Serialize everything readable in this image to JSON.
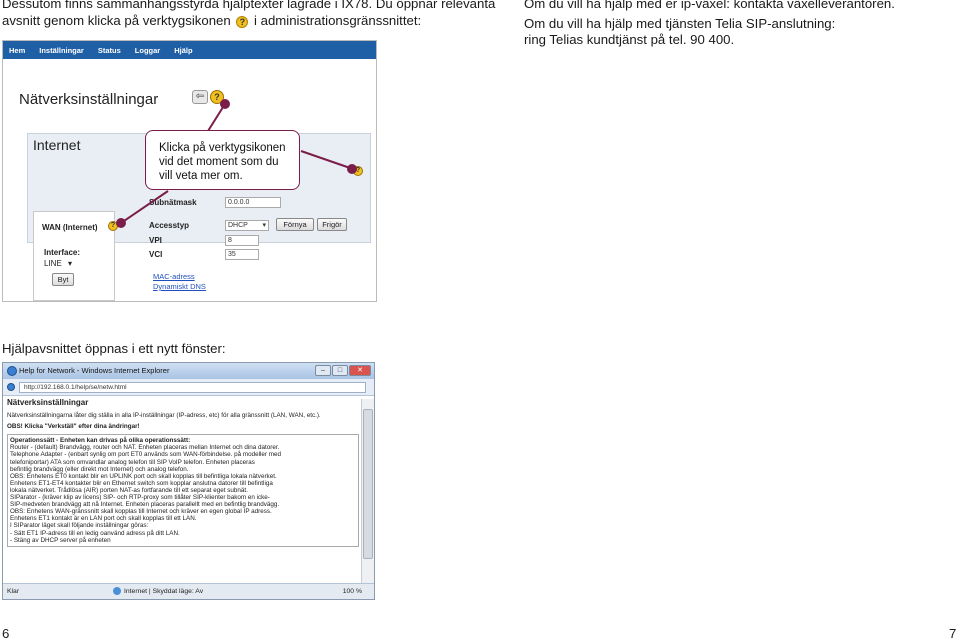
{
  "intro": {
    "line1": "Dessutom finns sammanhangsstyrda hjälptexter lagrade i IX78. Du öppnar relevanta",
    "line2_a": "avsnitt genom klicka på verktygsikonen",
    "line2_b": "i administrationsgränssnittet:"
  },
  "right": {
    "line1": "Om du vill ha hjälp med er ip-växel: kontakta växelleverantören.",
    "line2": "Om du vill ha hjälp med tjänsten Telia SIP-anslutning:",
    "line3": "ring Telias kundtjänst på tel. 90 400."
  },
  "help_icon_glyph": "?",
  "router_ui": {
    "nav": [
      "Hem",
      "Inställningar",
      "Status",
      "Loggar",
      "Hjälp"
    ],
    "page_title": "Nätverksinställningar",
    "back_glyph": "⇦",
    "help_glyph": "?",
    "section_title": "Internet",
    "wan_label": "WAN (Internet)",
    "interface_label": "Interface:",
    "interface_value": "LINE",
    "change_button": "Byt",
    "subnet_label": "Subnätmask",
    "subnet_value": "0.0.0.0",
    "access_label": "Accesstyp",
    "access_value": "DHCP",
    "renew_button": "Förnya",
    "release_button": "Frigör",
    "vpi_label": "VPI",
    "vpi_value": "8",
    "vci_label": "VCI",
    "vci_value": "35",
    "mac_link": "MAC-adress",
    "dns_link": "Dynamiskt DNS"
  },
  "callout": {
    "line1": "Klicka på verktygsikonen",
    "line2": "vid det moment som du",
    "line3": "vill veta mer om."
  },
  "caption_help_window": "Hjälpavsnittet öppnas i ett nytt fönster:",
  "ie_window": {
    "title": "Help for Network - Windows Internet Explorer",
    "url": "http://192.168.0.1/help/se/netw.html",
    "heading": "Nätverksinställningar",
    "para1": "Nätverksinställningarna låter dig ställa in alla IP-inställningar (IP-adress, etc) för alla gränssnitt (LAN, WAN, etc.).",
    "note": "OBS! Klicka \"Verkställ\" efter dina ändringar!",
    "ops": [
      "Operationssätt - Enheten kan drivas på olika operationssätt:",
      "Router - (default) Brandvägg, router och NAT. Enheten placeras mellan Internet och dina datorer.",
      "Telephone Adapter - (enbart synlig om port ET0 används som WAN-förbindelse. på modeller med",
      "telefoniportar) ATA som omvandlar analog telefon till SIP VoIP telefon. Enheten placeras",
      "befintlig brandvägg (eller direkt mot Internet) och analog telefon.",
      "OBS: Enhetens ET0 kontakt blir en UPLINK port och skall kopplas till befintliga lokala nätverket.",
      "Enhetens ET1-ET4 kontakter blir en Ethernet switch som kopplar anslutna datorer till befintliga",
      "lokala nätverket. Trådlösa (AIR) porten NAT-as fortfarande till ett separat eget subnät.",
      "SIParator - (kräver klip av licens) SIP- och RTP-proxy som tillåter SIP-klienter bakom en icke-",
      "SIP-medveten brandvägg att nå Internet. Enheten placeras parallellt med en befintlig brandvägg.",
      "OBS: Enhetens WAN-gränssnitt skall kopplas till Internet och kräver en egen global IP adress.",
      "Enhetens ET1 kontakt är en LAN port och skall kopplas till ett LAN.",
      "I SIParator läget skall följande inställningar göras:",
      " - Sätt ET1 IP-adress till en ledig oanvänd adress på ditt LAN.",
      " - Stäng av DHCP server på enheten"
    ],
    "status_left": "Klar",
    "status_zone": "Internet | Skyddat läge: Av",
    "zoom": "100 %"
  },
  "page_numbers": {
    "left": "6",
    "right": "7"
  }
}
